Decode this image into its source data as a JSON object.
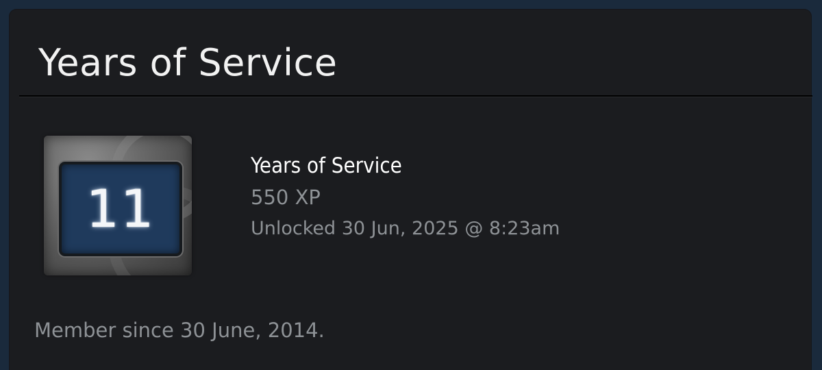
{
  "panel": {
    "title": "Years of Service"
  },
  "badge": {
    "icon": "years-of-service-badge-icon",
    "number": "11",
    "name": "Years of Service",
    "xp": "550 XP",
    "unlocked": "Unlocked 30 Jun, 2025 @ 8:23am",
    "screen_color": "#1f3a5c"
  },
  "footer": {
    "member_since": "Member since 30 June, 2014."
  },
  "colors": {
    "page_background": "#1a2a3c",
    "panel_background": "#1b1c1f",
    "primary_text": "#ffffff",
    "secondary_text": "#8e9296"
  }
}
